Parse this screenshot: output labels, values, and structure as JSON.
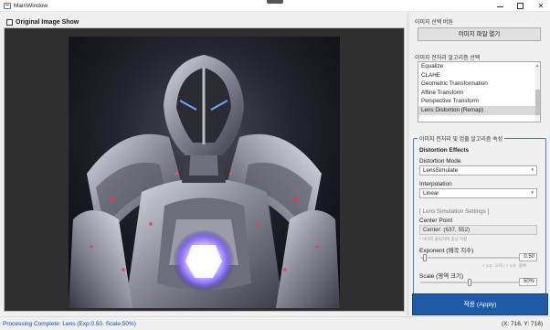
{
  "window": {
    "title": "MainWindow"
  },
  "left": {
    "original_checkbox_label": "Original Image Show",
    "original_checked": false
  },
  "right": {
    "image_select": {
      "group_title": "이미지 선택 버튼",
      "open_button": "이미지 파일 열기"
    },
    "algorithm_select": {
      "group_title": "이미지 전처리 알고리즘 선택",
      "items": [
        "Equalize",
        "CLAHE",
        "Geometric Transformation",
        "Affine Transform",
        "Perspective Transform",
        "Lens Distortion (Remap)"
      ],
      "selected_index": 5
    },
    "properties": {
      "group_title": "이미지 전처리 및 업출 알고리즘 속성",
      "section_title": "Distortion Effects",
      "mode_label": "Distortion Mode",
      "mode_value": "LensSimulate",
      "interp_label": "Interpolation",
      "interp_value": "Linear",
      "lens_section": "[ Lens Simulation Settings ]",
      "center_label": "Center Point",
      "center_value": "Center: (637, 552)",
      "center_hint": "* 이미지 클릭하여 중심 지정",
      "exponent_label": "Exponent (왜곡 지수)",
      "exponent_value": "0.50",
      "exponent_hint": "< 1.0 : 오목 | > 1.0 : 볼록",
      "exponent_slider": 0.05,
      "scale_label": "Scale (영역 크기)",
      "scale_value": "50%",
      "scale_slider": 0.5
    },
    "apply_button": "적용 (Apply)"
  },
  "status": {
    "message": "Processing Complete: Lens (Exp:0.50, Scale:50%)",
    "coords": "(X: 716, Y: 718)"
  },
  "colors": {
    "status_text": "#1346d6",
    "apply_bg": "#1f5aa6",
    "frame_border": "#4a7cbf",
    "image_bg": "#2f2f2f"
  }
}
